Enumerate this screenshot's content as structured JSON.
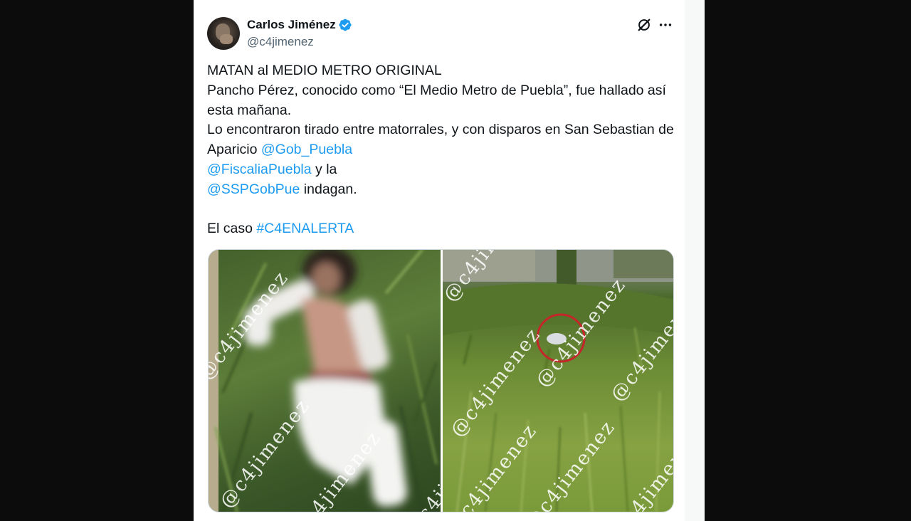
{
  "author": {
    "name": "Carlos Jiménez",
    "handle": "@c4jimenez",
    "verified_color": "#1d9bf0"
  },
  "header_icons": [
    "grok-icon",
    "more-options-icon"
  ],
  "tweet": {
    "line1": "MATAN al MEDIO METRO ORIGINAL",
    "line2": "Pancho Pérez, conocido como “El Medio Metro de Puebla”, fue hallado así esta mañana.",
    "line3": "Lo encontraron tirado entre matorrales, y con disparos en San Sebastian de Aparicio ",
    "mention1": "@Gob_Puebla",
    "mention2": "@FiscaliaPuebla",
    "text_yla": " y la",
    "mention3": "@SSPGobPue",
    "text_indagan": " indagan.",
    "text_elcaso": "El caso ",
    "hashtag": "#C4ENALERTA"
  },
  "media": {
    "watermark": "@c4jimenez",
    "photos": [
      "left-photo",
      "right-photo"
    ]
  },
  "colors": {
    "link": "#1d9bf0",
    "text": "#0f1419",
    "muted": "#536471",
    "background": "#0c0c0c"
  }
}
